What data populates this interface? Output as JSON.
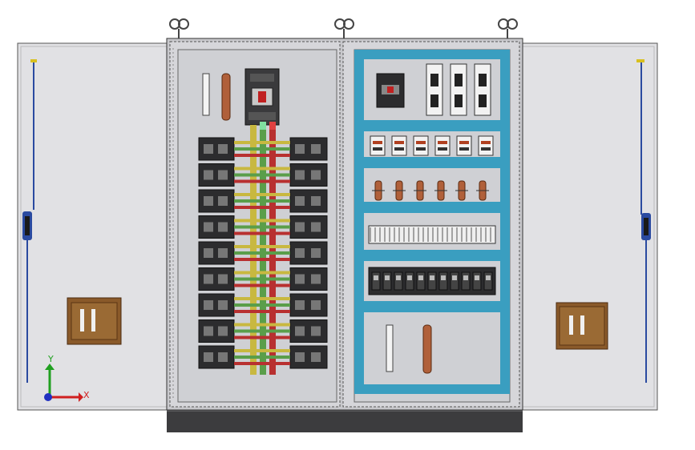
{
  "axes": {
    "x_label": "X",
    "y_label": "Y"
  },
  "colors": {
    "background": "#ffffff",
    "door_panel": "#e1e1e4",
    "cabinet_frame": "#c8c8cc",
    "mounting_plate": "#cfd0d4",
    "plinth": "#3c3c3e",
    "rail_blue": "#3a9ec0",
    "breaker_dark": "#2c2c2e",
    "bus_yellow": "#c8b840",
    "bus_green": "#5a9e4a",
    "bus_red": "#b83030",
    "copper": "#b0603a",
    "handle_brown": "#8a5a2a",
    "door_rod_blue": "#2a4aa0",
    "axis_x": "#d02020",
    "axis_y": "#20a020",
    "axis_z": "#2030c0"
  },
  "icons": [
    "lifting-eye-icon",
    "door-handle-icon",
    "coordinate-triad-icon"
  ]
}
